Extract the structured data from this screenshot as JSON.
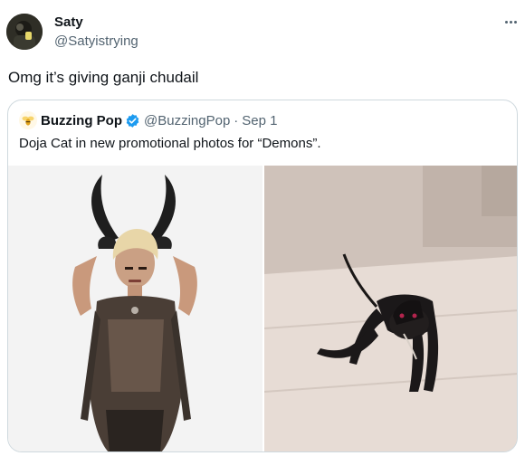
{
  "tweet": {
    "author_name": "Saty",
    "author_handle": "@Satyistrying",
    "text": "Omg it’s giving ganji chudail"
  },
  "quote": {
    "author_name": "Buzzing Pop",
    "author_handle": "@BuzzingPop",
    "separator": "·",
    "date": "Sep 1",
    "text": "Doja Cat in new promotional photos for “Demons”."
  },
  "icons": {
    "avatar": "avatar-photo",
    "more": "more-options-icon",
    "quote_logo": "bee-logo-icon",
    "verified": "verified-badge-icon"
  },
  "colors": {
    "verified": "#1d9bf0",
    "secondary_text": "#536471",
    "border": "#cfd9de"
  }
}
